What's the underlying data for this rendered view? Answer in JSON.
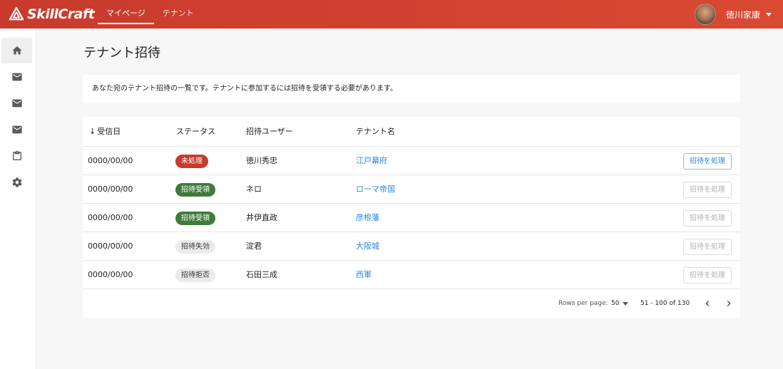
{
  "app": {
    "brand": "SkillCraft"
  },
  "nav": {
    "items": [
      {
        "label": "マイページ"
      },
      {
        "label": "テナント"
      }
    ]
  },
  "user": {
    "name": "徳川家康"
  },
  "sidebar": {
    "icons": [
      "home-icon",
      "mail-icon",
      "mail-icon",
      "mail-icon",
      "clipboard-icon",
      "gear-icon"
    ]
  },
  "page": {
    "title": "テナント招待",
    "description": "あなた宛のテナント招待の一覧です。テナントに参加するには招待を受領する必要があります。"
  },
  "table": {
    "columns": {
      "received": "受信日",
      "status": "ステータス",
      "user": "招待ユーザー",
      "tenant": "テナント名"
    },
    "sort_indicator": "↓",
    "action_label": "招待を処理",
    "rows": [
      {
        "date": "0000/00/00",
        "status": "未処理",
        "user": "徳川秀忠",
        "tenant": "江戸幕府"
      },
      {
        "date": "0000/00/00",
        "status": "招待受領",
        "user": "ネロ",
        "tenant": "ローマ帝国"
      },
      {
        "date": "0000/00/00",
        "status": "招待受領",
        "user": "井伊直政",
        "tenant": "彦根藩"
      },
      {
        "date": "0000/00/00",
        "status": "招待失効",
        "user": "淀君",
        "tenant": "大阪城"
      },
      {
        "date": "0000/00/00",
        "status": "招待拒否",
        "user": "石田三成",
        "tenant": "西軍"
      }
    ]
  },
  "pagination": {
    "rows_per_page_label": "Rows per page:",
    "rows_per_page": "50",
    "range": "51 - 100 of 130"
  },
  "colors": {
    "header": "#c83a2c",
    "chip_pending": "#c83a2c",
    "chip_accepted": "#3f7a3c",
    "link": "#2e86de"
  }
}
